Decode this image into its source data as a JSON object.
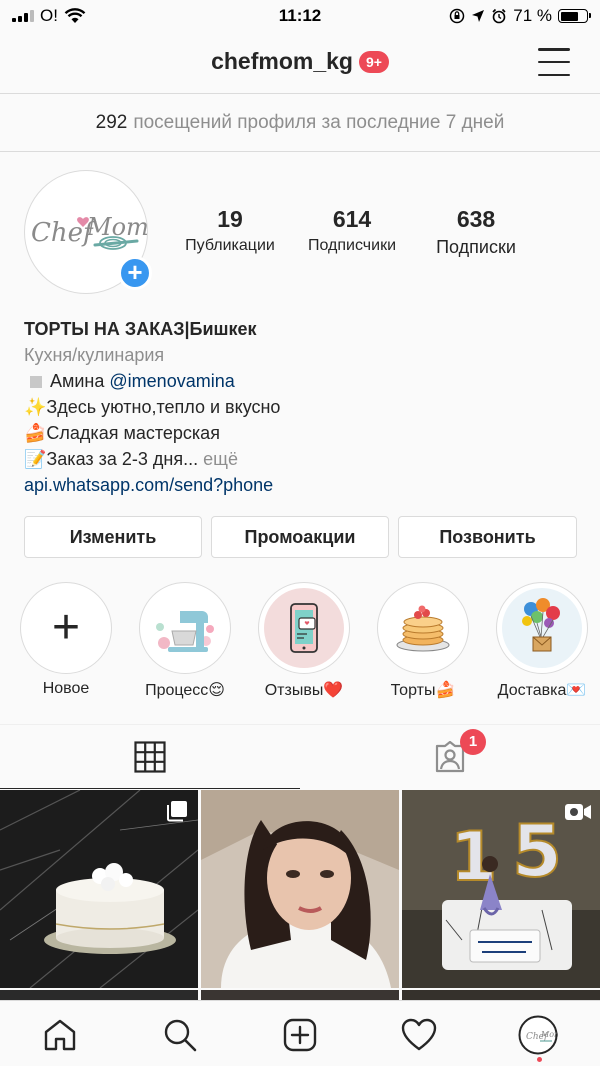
{
  "status_bar": {
    "carrier": "O!",
    "time": "11:12",
    "battery_text": "71 %",
    "battery_level": 0.71
  },
  "header": {
    "username": "chefmom_kg",
    "notifications_badge": "9+"
  },
  "visits": {
    "count": "292",
    "text": "посещений профиля за последние 7 дней"
  },
  "profile": {
    "avatar_text": "Chef Mom",
    "stats": [
      {
        "value": "19",
        "label": "Публикации"
      },
      {
        "value": "614",
        "label": "Подписчики"
      },
      {
        "value": "638",
        "label": "Подписки"
      }
    ]
  },
  "bio": {
    "name": "ТОРТЫ НА ЗАКАЗ|Бишкек",
    "category": "Кухня/кулинария",
    "line1_prefix": "Амина",
    "line1_mention": "@imenovamina",
    "line2": "✨Здесь уютно,тепло и вкусно",
    "line3": "🍰Сладкая мастерская",
    "line4": "📝Заказ за 2-3 дня...",
    "more": "ещё",
    "link": "api.whatsapp.com/send?phone"
  },
  "buttons": {
    "edit": "Изменить",
    "promo": "Промоакции",
    "call": "Позвонить"
  },
  "highlights": [
    {
      "label": "Новое"
    },
    {
      "label": "Процесс😌"
    },
    {
      "label": "Отзывы❤️"
    },
    {
      "label": "Торты🍰"
    },
    {
      "label": "Доставка💌"
    }
  ],
  "tabs": {
    "tagged_badge": "1"
  },
  "colors": {
    "accent_blue": "#3897f0",
    "badge_red": "#ed4956",
    "link_blue": "#003569"
  }
}
